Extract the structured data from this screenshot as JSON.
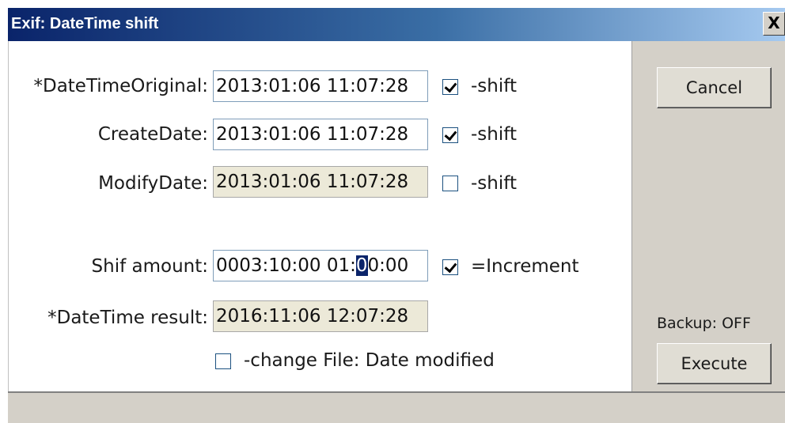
{
  "window": {
    "title": "Exif: DateTime shift",
    "close_label": "X"
  },
  "fields": {
    "date_time_original": {
      "label": "*DateTimeOriginal:",
      "value": "2013:01:06 11:07:28",
      "shift_label": "-shift",
      "shift_checked": true
    },
    "create_date": {
      "label": "CreateDate:",
      "value": "2013:01:06 11:07:28",
      "shift_label": "-shift",
      "shift_checked": true
    },
    "modify_date": {
      "label": "ModifyDate:",
      "value": "2013:01:06 11:07:28",
      "shift_label": "-shift",
      "shift_checked": false
    },
    "shift_amount": {
      "label": "Shif amount:",
      "value_before": "0003:10:00 01:",
      "value_selected": "0",
      "value_after": "0:00",
      "increment_label": "=Increment",
      "increment_checked": true
    },
    "result": {
      "label": "*DateTime result:",
      "value": "2016:11:06 12:07:28"
    }
  },
  "change_file": {
    "label": "-change File: Date modified",
    "checked": false
  },
  "buttons": {
    "cancel": "Cancel",
    "execute": "Execute"
  },
  "backup_status": "Backup: OFF"
}
